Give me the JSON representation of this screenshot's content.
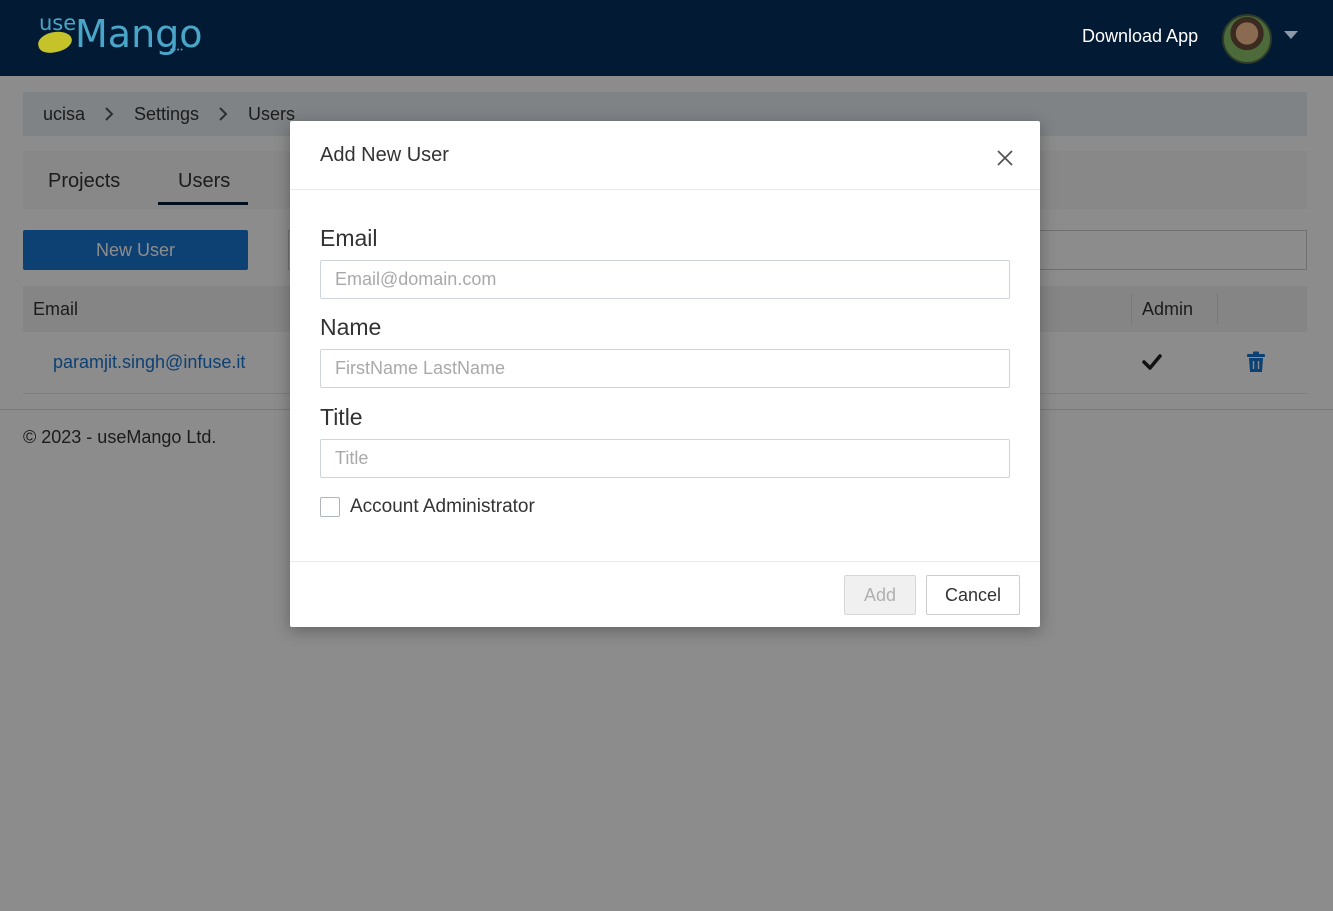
{
  "header": {
    "logo_use": "use",
    "logo_mango": "Mango",
    "download_app": "Download App"
  },
  "breadcrumb": [
    "ucisa",
    "Settings",
    "Users"
  ],
  "tabs": [
    {
      "label": "Projects",
      "active": false
    },
    {
      "label": "Users",
      "active": true
    }
  ],
  "toolbar": {
    "new_user_label": "New User"
  },
  "table": {
    "columns": [
      "Email",
      "Admin"
    ],
    "rows": [
      {
        "email": "paramjit.singh@infuse.it",
        "admin": true
      }
    ]
  },
  "footer": {
    "copyright": "© 2023 - useMango Ltd."
  },
  "modal": {
    "title": "Add New User",
    "email_label": "Email",
    "email_placeholder": "Email@domain.com",
    "email_value": "",
    "name_label": "Name",
    "name_placeholder": "FirstName LastName",
    "name_value": "",
    "title_label": "Title",
    "title_placeholder": "Title",
    "title_value": "",
    "admin_checkbox_label": "Account Administrator",
    "admin_checked": false,
    "add_label": "Add",
    "cancel_label": "Cancel"
  },
  "colors": {
    "header_bg": "#021a33",
    "primary": "#1976d2",
    "logo": "#4aa6c8"
  }
}
